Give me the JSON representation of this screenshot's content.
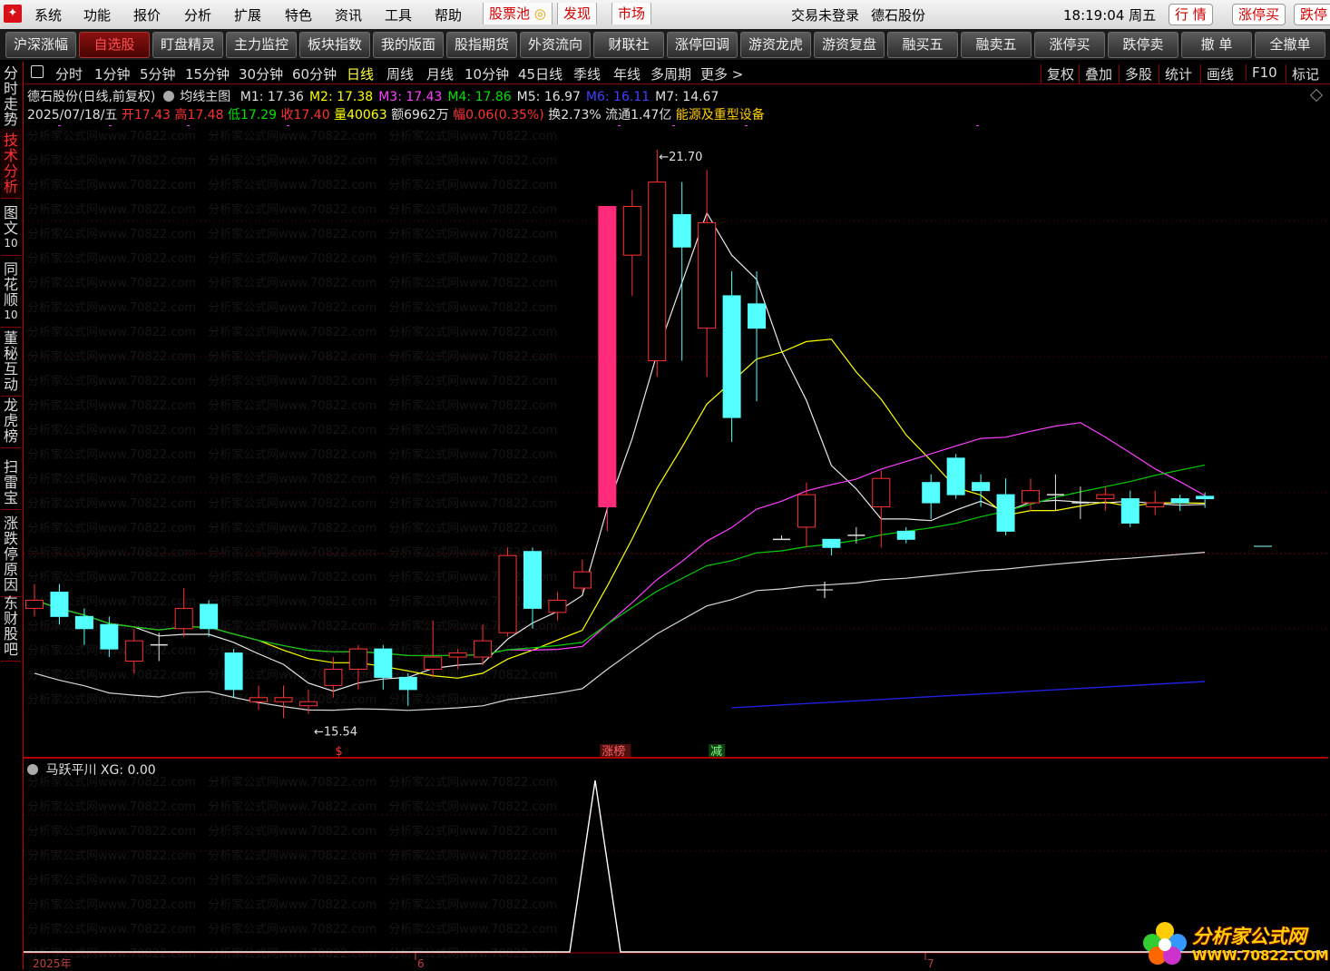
{
  "menu": {
    "items": [
      "系统",
      "功能",
      "报价",
      "分析",
      "扩展",
      "特色",
      "资讯",
      "工具",
      "帮助"
    ],
    "highlight": [
      "股票池",
      "发现",
      "市场"
    ],
    "status": "交易未登录",
    "stock": "德石股份",
    "time": "18:19:04 周五",
    "right_buttons": [
      "行 情",
      "涨停买",
      "跌停"
    ]
  },
  "toolbar": [
    "沪深涨幅",
    "自选股",
    "盯盘精灵",
    "主力监控",
    "板块指数",
    "我的版面",
    "股指期货",
    "外资流向",
    "财联社",
    "涨停回调",
    "游资龙虎",
    "游资复盘",
    "融买五",
    "融卖五",
    "涨停买",
    "跌停卖",
    "撤 单",
    "全撤单"
  ],
  "toolbar_active": "自选股",
  "lefttabs": [
    {
      "chars": [
        "分",
        "时",
        "走",
        "势"
      ]
    },
    {
      "chars": [
        "技",
        "术",
        "分",
        "析"
      ],
      "active": true
    },
    {
      "chars": [
        "图",
        "文",
        "10"
      ]
    },
    {
      "chars": [
        "同",
        "花",
        "顺",
        "10"
      ]
    },
    {
      "chars": [
        "董",
        "秘",
        "互",
        "动"
      ]
    },
    {
      "chars": [
        "龙",
        "虎",
        "榜"
      ]
    },
    {
      "chars": [
        "扫",
        "雷",
        "宝"
      ]
    },
    {
      "chars": [
        "涨",
        "跌",
        "停",
        "原",
        "因"
      ]
    },
    {
      "chars": [
        "东",
        "财",
        "股",
        "吧"
      ]
    }
  ],
  "periods": [
    "分时",
    "1分钟",
    "5分钟",
    "15分钟",
    "30分钟",
    "60分钟",
    "日线",
    "周线",
    "月线",
    "10分钟",
    "45日线",
    "季线",
    "年线",
    "多周期",
    "更多 >"
  ],
  "period_active": "日线",
  "period_right": [
    "复权",
    "叠加",
    "多股",
    "统计",
    "画线",
    "F10",
    "标记"
  ],
  "header": {
    "name": "德石股份(日线,前复权)",
    "indicator": "均线主图",
    "ma": [
      {
        "label": "M1: 17.36",
        "color": "#e0e0e0"
      },
      {
        "label": "M2: 17.38",
        "color": "#ffff00"
      },
      {
        "label": "M3: 17.43",
        "color": "#ff40ff"
      },
      {
        "label": "M4: 17.86",
        "color": "#00e000"
      },
      {
        "label": "M5: 16.97",
        "color": "#e0e0e0"
      },
      {
        "label": "M6: 16.11",
        "color": "#4040ff"
      },
      {
        "label": "M7: 14.67",
        "color": "#e0e0e0"
      }
    ],
    "date": "2025/07/18/五",
    "open_l": "开",
    "open": "17.43",
    "high_l": "高",
    "high": "17.48",
    "low_l": "低",
    "low": "17.29",
    "close_l": "收",
    "close": "17.40",
    "vol_l": "量",
    "vol": "40063",
    "amt_l": "额",
    "amt": "6962万",
    "chg_l": "幅",
    "chg": "0.06(0.35%)",
    "turn_l": "换",
    "turn": "2.73%",
    "float_l": "流通",
    "float": "1.47亿",
    "sector": "能源及重型设备"
  },
  "chart_data": {
    "type": "candlestick",
    "y_range": [
      14.4,
      22.0
    ],
    "annotations": {
      "max": "21.70",
      "min": "15.54"
    },
    "markers": [
      "$",
      "涨榜",
      "减"
    ],
    "candles": [
      {
        "o": 16.05,
        "c": 16.15,
        "h": 16.35,
        "l": 15.95
      },
      {
        "o": 16.25,
        "c": 15.95,
        "h": 16.35,
        "l": 15.85
      },
      {
        "o": 15.95,
        "c": 15.8,
        "h": 16.05,
        "l": 15.6
      },
      {
        "o": 15.85,
        "c": 15.55,
        "h": 15.95,
        "l": 15.45
      },
      {
        "o": 15.4,
        "c": 15.65,
        "h": 15.8,
        "l": 15.25
      },
      {
        "o": 15.6,
        "c": 15.6,
        "h": 15.75,
        "l": 15.4
      },
      {
        "o": 15.8,
        "c": 16.05,
        "h": 16.3,
        "l": 15.7
      },
      {
        "o": 16.1,
        "c": 15.8,
        "h": 16.15,
        "l": 15.7
      },
      {
        "o": 15.5,
        "c": 15.05,
        "h": 15.55,
        "l": 14.95
      },
      {
        "o": 14.9,
        "c": 14.95,
        "h": 15.1,
        "l": 14.8
      },
      {
        "o": 14.9,
        "c": 14.95,
        "h": 15.1,
        "l": 14.7
      },
      {
        "o": 14.85,
        "c": 14.9,
        "h": 15.05,
        "l": 14.75
      },
      {
        "o": 15.1,
        "c": 15.3,
        "h": 15.45,
        "l": 14.95
      },
      {
        "o": 15.3,
        "c": 15.55,
        "h": 15.6,
        "l": 15.05
      },
      {
        "o": 15.55,
        "c": 15.2,
        "h": 15.6,
        "l": 15.05
      },
      {
        "o": 15.2,
        "c": 15.05,
        "h": 15.25,
        "l": 14.85
      },
      {
        "o": 15.3,
        "c": 15.45,
        "h": 15.9,
        "l": 15.2
      },
      {
        "o": 15.45,
        "c": 15.5,
        "h": 15.55,
        "l": 15.3
      },
      {
        "o": 15.45,
        "c": 15.65,
        "h": 15.85,
        "l": 15.35
      },
      {
        "o": 15.75,
        "c": 16.7,
        "h": 16.8,
        "l": 15.7
      },
      {
        "o": 16.75,
        "c": 16.05,
        "h": 16.8,
        "l": 15.8
      },
      {
        "o": 16.0,
        "c": 16.15,
        "h": 16.25,
        "l": 15.9
      },
      {
        "o": 16.3,
        "c": 16.5,
        "h": 16.65,
        "l": 16.25
      },
      {
        "o": 17.3,
        "c": 21.0,
        "h": 21.0,
        "l": 17.0
      },
      {
        "o": 20.4,
        "c": 21.0,
        "h": 21.2,
        "l": 19.9
      },
      {
        "o": 19.1,
        "c": 21.3,
        "h": 21.7,
        "l": 18.9
      },
      {
        "o": 20.9,
        "c": 20.5,
        "h": 21.3,
        "l": 19.1
      },
      {
        "o": 19.5,
        "c": 20.8,
        "h": 21.45,
        "l": 18.9
      },
      {
        "o": 19.9,
        "c": 18.4,
        "h": 20.2,
        "l": 18.1
      },
      {
        "o": 19.8,
        "c": 19.5,
        "h": 20.2,
        "l": 18.6
      },
      {
        "o": 16.9,
        "c": 16.9,
        "h": 16.95,
        "l": 16.9
      },
      {
        "o": 17.05,
        "c": 17.45,
        "h": 17.6,
        "l": 16.8
      },
      {
        "o": 16.9,
        "c": 16.8,
        "h": 16.9,
        "l": 16.7
      },
      {
        "o": 16.95,
        "c": 16.95,
        "h": 17.05,
        "l": 16.85
      },
      {
        "o": 17.3,
        "c": 17.65,
        "h": 17.75,
        "l": 16.8
      },
      {
        "o": 17.0,
        "c": 16.9,
        "h": 17.05,
        "l": 16.85
      },
      {
        "o": 17.6,
        "c": 17.35,
        "h": 17.7,
        "l": 17.15
      },
      {
        "o": 17.9,
        "c": 17.45,
        "h": 17.95,
        "l": 17.4
      },
      {
        "o": 17.6,
        "c": 17.5,
        "h": 17.7,
        "l": 17.3
      },
      {
        "o": 17.45,
        "c": 17.0,
        "h": 17.65,
        "l": 16.95
      },
      {
        "o": 17.35,
        "c": 17.5,
        "h": 17.65,
        "l": 17.25
      },
      {
        "o": 17.45,
        "c": 17.45,
        "h": 17.7,
        "l": 17.25
      },
      {
        "o": 17.35,
        "c": 17.35,
        "h": 17.55,
        "l": 17.15
      },
      {
        "o": 17.4,
        "c": 17.45,
        "h": 17.55,
        "l": 17.25
      },
      {
        "o": 17.4,
        "c": 17.1,
        "h": 17.5,
        "l": 17.05
      },
      {
        "o": 17.3,
        "c": 17.35,
        "h": 17.5,
        "l": 17.2
      },
      {
        "o": 17.4,
        "c": 17.35,
        "h": 17.45,
        "l": 17.25
      },
      {
        "o": 17.43,
        "c": 17.4,
        "h": 17.48,
        "l": 17.29
      }
    ]
  },
  "sub": {
    "title": "马跃平川",
    "xg": "XG: 0.00",
    "dates": [
      "2025年",
      "6",
      "7"
    ]
  },
  "brand": {
    "name": "分析家公式网",
    "url": "WWW.70822.COM"
  }
}
